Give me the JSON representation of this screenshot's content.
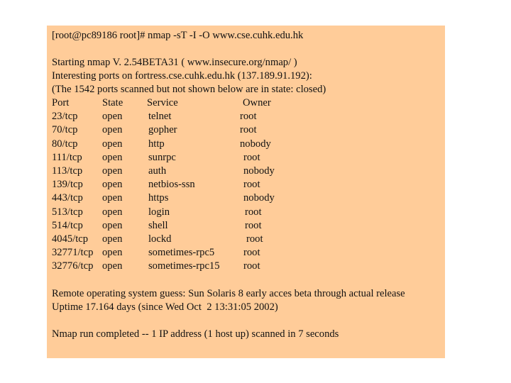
{
  "command": "[root@pc89186 root]# nmap -sT -I -O www.cse.cuhk.edu.hk",
  "header_lines": [
    "Starting nmap V. 2.54BETA31 ( www.insecure.org/nmap/ )",
    "Interesting ports on fortress.cse.cuhk.edu.hk (137.189.91.192):",
    "(The 1542 ports scanned but not shown below are in state: closed)"
  ],
  "table": {
    "columns": [
      "Port",
      "State",
      "Service",
      "Owner"
    ],
    "rows": [
      [
        "23/tcp",
        "open",
        "telnet",
        "root"
      ],
      [
        "70/tcp",
        "open",
        "gopher",
        "root"
      ],
      [
        "80/tcp",
        "open",
        "http",
        "nobody"
      ],
      [
        "111/tcp",
        "open",
        "sunrpc",
        "root"
      ],
      [
        "113/tcp",
        "open",
        "auth",
        "nobody"
      ],
      [
        "139/tcp",
        "open",
        "netbios-ssn",
        "root"
      ],
      [
        "443/tcp",
        "open",
        "https",
        "nobody"
      ],
      [
        "513/tcp",
        "open",
        "login",
        "root"
      ],
      [
        "514/tcp",
        "open",
        "shell",
        "root"
      ],
      [
        "4045/tcp",
        "open",
        "lockd",
        "root"
      ],
      [
        "32771/tcp",
        "open",
        "sometimes-rpc5",
        "root"
      ],
      [
        "32776/tcp",
        "open",
        "sometimes-rpc15",
        "root"
      ]
    ]
  },
  "footer_lines": [
    "Remote operating system guess: Sun Solaris 8 early acces beta through actual release",
    "Uptime 17.164 days (since Wed Oct  2 13:31:05 2002)"
  ],
  "completion": "Nmap run completed -- 1 IP address (1 host up) scanned in 7 seconds",
  "colors": {
    "background": "#ffcc99",
    "text": "#111111"
  }
}
